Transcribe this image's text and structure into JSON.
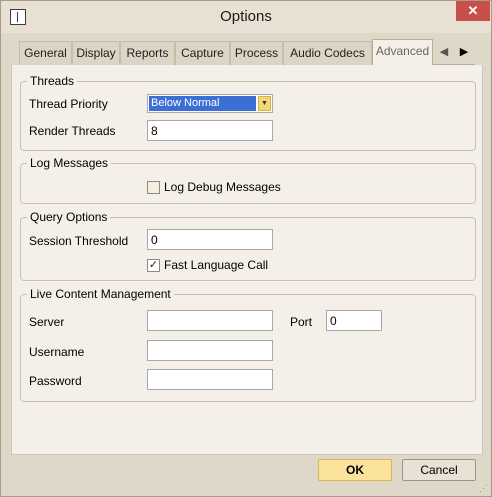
{
  "window": {
    "title": "Options",
    "close_label": "✕"
  },
  "tabs": [
    {
      "label": "General"
    },
    {
      "label": "Display"
    },
    {
      "label": "Reports"
    },
    {
      "label": "Capture"
    },
    {
      "label": "Process"
    },
    {
      "label": "Audio Codecs"
    },
    {
      "label": "Advanced",
      "active": true
    }
  ],
  "tab_scroll": {
    "left": "◀",
    "right": "▶"
  },
  "threads": {
    "title": "Threads",
    "priority_label": "Thread Priority",
    "priority_value": "Below Normal",
    "render_label": "Render Threads",
    "render_value": "8"
  },
  "log": {
    "title": "Log Messages",
    "debug_label": "Log Debug Messages",
    "debug_checked": false
  },
  "query": {
    "title": "Query Options",
    "threshold_label": "Session Threshold",
    "threshold_value": "0",
    "fast_label": "Fast Language Call",
    "fast_checked": true
  },
  "live": {
    "title": "Live Content Management",
    "server_label": "Server",
    "server_value": "",
    "port_label": "Port",
    "port_value": "0",
    "username_label": "Username",
    "username_value": "",
    "password_label": "Password",
    "password_value": ""
  },
  "buttons": {
    "ok": "OK",
    "cancel": "Cancel"
  },
  "icons": {
    "check": "✓",
    "dropdown": "▼"
  }
}
